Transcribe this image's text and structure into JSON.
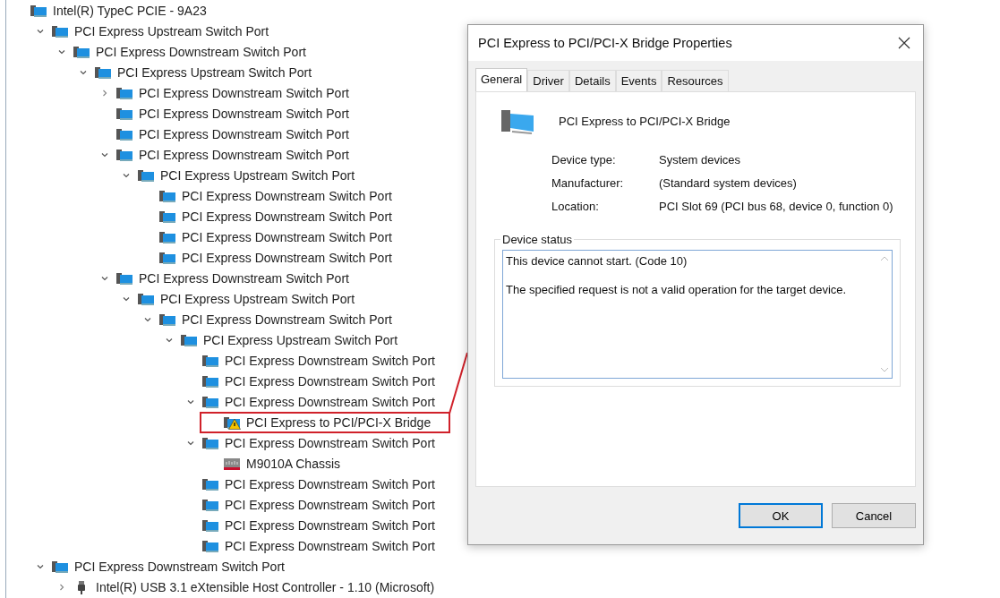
{
  "tree": [
    {
      "label": "Intel(R) TypeC PCIE - 9A23",
      "kind": "device",
      "children": [
        {
          "label": "PCI Express Upstream Switch Port",
          "kind": "device",
          "expanded": true,
          "children": [
            {
              "label": "PCI Express Downstream Switch Port",
              "kind": "device",
              "expanded": true,
              "children": [
                {
                  "label": "PCI Express Upstream Switch Port",
                  "kind": "device",
                  "expanded": true,
                  "children": [
                    {
                      "label": "PCI Express Downstream Switch Port",
                      "kind": "device",
                      "expanded": false
                    },
                    {
                      "label": "PCI Express Downstream Switch Port",
                      "kind": "device"
                    },
                    {
                      "label": "PCI Express Downstream Switch Port",
                      "kind": "device"
                    },
                    {
                      "label": "PCI Express Downstream Switch Port",
                      "kind": "device",
                      "expanded": true,
                      "children": [
                        {
                          "label": "PCI Express Upstream Switch Port",
                          "kind": "device",
                          "expanded": true,
                          "children": [
                            {
                              "label": "PCI Express Downstream Switch Port",
                              "kind": "device"
                            },
                            {
                              "label": "PCI Express Downstream Switch Port",
                              "kind": "device"
                            },
                            {
                              "label": "PCI Express Downstream Switch Port",
                              "kind": "device"
                            },
                            {
                              "label": "PCI Express Downstream Switch Port",
                              "kind": "device"
                            }
                          ]
                        }
                      ]
                    },
                    {
                      "label": "PCI Express Downstream Switch Port",
                      "kind": "device",
                      "expanded": true,
                      "children": [
                        {
                          "label": "PCI Express Upstream Switch Port",
                          "kind": "device",
                          "expanded": true,
                          "children": [
                            {
                              "label": "PCI Express Downstream Switch Port",
                              "kind": "device",
                              "expanded": true,
                              "children": [
                                {
                                  "label": "PCI Express Upstream Switch Port",
                                  "kind": "device",
                                  "expanded": true,
                                  "children": [
                                    {
                                      "label": "PCI Express Downstream Switch Port",
                                      "kind": "device"
                                    },
                                    {
                                      "label": "PCI Express Downstream Switch Port",
                                      "kind": "device"
                                    },
                                    {
                                      "label": "PCI Express Downstream Switch Port",
                                      "kind": "device",
                                      "expanded": true,
                                      "children": [
                                        {
                                          "label": "PCI Express to PCI/PCI-X Bridge",
                                          "kind": "warning",
                                          "highlighted": true
                                        }
                                      ]
                                    },
                                    {
                                      "label": "PCI Express Downstream Switch Port",
                                      "kind": "device",
                                      "expanded": true,
                                      "children": [
                                        {
                                          "label": "M9010A Chassis",
                                          "kind": "chassis"
                                        }
                                      ]
                                    },
                                    {
                                      "label": "PCI Express Downstream Switch Port",
                                      "kind": "device"
                                    },
                                    {
                                      "label": "PCI Express Downstream Switch Port",
                                      "kind": "device"
                                    },
                                    {
                                      "label": "PCI Express Downstream Switch Port",
                                      "kind": "device"
                                    },
                                    {
                                      "label": "PCI Express Downstream Switch Port",
                                      "kind": "device"
                                    }
                                  ]
                                }
                              ]
                            }
                          ]
                        }
                      ]
                    }
                  ]
                }
              ]
            }
          ]
        },
        {
          "label": "PCI Express Downstream Switch Port",
          "kind": "device",
          "expanded": true,
          "children": [
            {
              "label": "Intel(R) USB 3.1 eXtensible Host Controller - 1.10 (Microsoft)",
              "kind": "usb",
              "expanded": false
            }
          ]
        }
      ]
    }
  ],
  "dialog": {
    "title": "PCI Express to PCI/PCI-X Bridge Properties",
    "tabs": [
      {
        "label": "General",
        "selected": true
      },
      {
        "label": "Driver",
        "selected": false
      },
      {
        "label": "Details",
        "selected": false
      },
      {
        "label": "Events",
        "selected": false
      },
      {
        "label": "Resources",
        "selected": false
      }
    ],
    "device_name": "PCI Express to PCI/PCI-X Bridge",
    "properties": [
      {
        "label": "Device type:",
        "value": "System devices"
      },
      {
        "label": "Manufacturer:",
        "value": "(Standard system devices)"
      },
      {
        "label": "Location:",
        "value": "PCI Slot 69 (PCI bus 68, device 0, function 0)"
      }
    ],
    "status_label": "Device status",
    "status_lines": [
      "This device cannot start. (Code 10)",
      "The specified request is not a valid operation for the target device."
    ],
    "buttons": [
      "OK",
      "Cancel"
    ]
  }
}
